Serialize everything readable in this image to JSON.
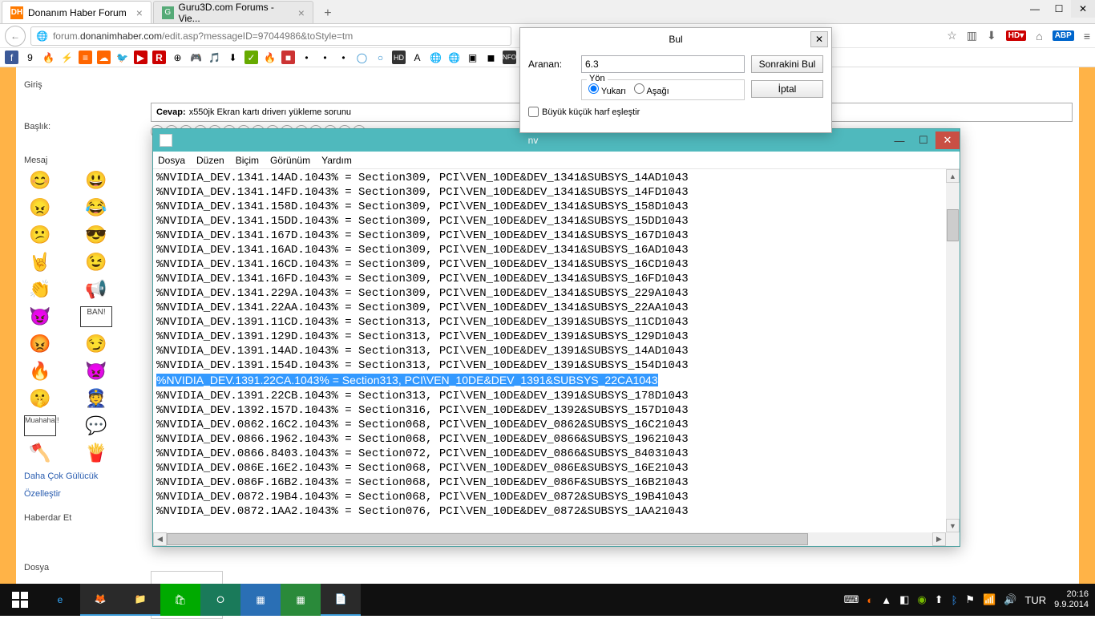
{
  "browser": {
    "tabs": [
      {
        "title": "Donanım Haber Forum",
        "favicon": "DH"
      },
      {
        "title": "Guru3D.com Forums - Vie...",
        "favicon": "G"
      }
    ],
    "url_display": "forum.donanimhaber.com/edit.asp?messageID=97044986&toStyle=tm",
    "url_host": "donanimhaber.com"
  },
  "find_dialog": {
    "title": "Bul",
    "search_label": "Aranan:",
    "search_value": "6.3",
    "next_btn": "Sonrakini Bul",
    "cancel_btn": "İptal",
    "direction_label": "Yön",
    "up_label": "Yukarı",
    "down_label": "Aşağı",
    "up_checked": true,
    "match_case_label": "Büyük küçük harf eşleştir"
  },
  "forum": {
    "giris": "Giriş",
    "baslik": "Başlık:",
    "mesaj": "Mesaj",
    "cevap_prefix": "Cevap:",
    "cevap_text": "x550jk Ekran kartı driverı yükleme sorunu",
    "more_smileys": "Daha Çok Gülücük",
    "customize": "Özelleştir",
    "notify": "Haberdar Et",
    "dosya": "Dosya"
  },
  "notepad": {
    "title": "nv",
    "menu": [
      "Dosya",
      "Düzen",
      "Biçim",
      "Görünüm",
      "Yardım"
    ],
    "selected_line_index": 14,
    "lines": [
      "%NVIDIA_DEV.1341.14AD.1043% = Section309, PCI\\VEN_10DE&DEV_1341&SUBSYS_14AD1043",
      "%NVIDIA_DEV.1341.14FD.1043% = Section309, PCI\\VEN_10DE&DEV_1341&SUBSYS_14FD1043",
      "%NVIDIA_DEV.1341.158D.1043% = Section309, PCI\\VEN_10DE&DEV_1341&SUBSYS_158D1043",
      "%NVIDIA_DEV.1341.15DD.1043% = Section309, PCI\\VEN_10DE&DEV_1341&SUBSYS_15DD1043",
      "%NVIDIA_DEV.1341.167D.1043% = Section309, PCI\\VEN_10DE&DEV_1341&SUBSYS_167D1043",
      "%NVIDIA_DEV.1341.16AD.1043% = Section309, PCI\\VEN_10DE&DEV_1341&SUBSYS_16AD1043",
      "%NVIDIA_DEV.1341.16CD.1043% = Section309, PCI\\VEN_10DE&DEV_1341&SUBSYS_16CD1043",
      "%NVIDIA_DEV.1341.16FD.1043% = Section309, PCI\\VEN_10DE&DEV_1341&SUBSYS_16FD1043",
      "%NVIDIA_DEV.1341.229A.1043% = Section309, PCI\\VEN_10DE&DEV_1341&SUBSYS_229A1043",
      "%NVIDIA_DEV.1341.22AA.1043% = Section309, PCI\\VEN_10DE&DEV_1341&SUBSYS_22AA1043",
      "%NVIDIA_DEV.1391.11CD.1043% = Section313, PCI\\VEN_10DE&DEV_1391&SUBSYS_11CD1043",
      "%NVIDIA_DEV.1391.129D.1043% = Section313, PCI\\VEN_10DE&DEV_1391&SUBSYS_129D1043",
      "%NVIDIA_DEV.1391.14AD.1043% = Section313, PCI\\VEN_10DE&DEV_1391&SUBSYS_14AD1043",
      "%NVIDIA_DEV.1391.154D.1043% = Section313, PCI\\VEN_10DE&DEV_1391&SUBSYS_154D1043",
      "%NVIDIA_DEV.1391.22CA.1043% = Section313, PCI\\VEN_10DE&DEV_1391&SUBSYS_22CA1043",
      "%NVIDIA_DEV.1391.22CB.1043% = Section313, PCI\\VEN_10DE&DEV_1391&SUBSYS_178D1043",
      "%NVIDIA_DEV.1392.157D.1043% = Section316, PCI\\VEN_10DE&DEV_1392&SUBSYS_157D1043",
      "%NVIDIA_DEV.0862.16C2.1043% = Section068, PCI\\VEN_10DE&DEV_0862&SUBSYS_16C21043",
      "%NVIDIA_DEV.0866.1962.1043% = Section068, PCI\\VEN_10DE&DEV_0866&SUBSYS_19621043",
      "%NVIDIA_DEV.0866.8403.1043% = Section072, PCI\\VEN_10DE&DEV_0866&SUBSYS_84031043",
      "%NVIDIA_DEV.086E.16E2.1043% = Section068, PCI\\VEN_10DE&DEV_086E&SUBSYS_16E21043",
      "%NVIDIA_DEV.086F.16B2.1043% = Section068, PCI\\VEN_10DE&DEV_086F&SUBSYS_16B21043",
      "%NVIDIA_DEV.0872.19B4.1043% = Section068, PCI\\VEN_10DE&DEV_0872&SUBSYS_19B41043",
      "%NVIDIA_DEV.0872.1AA2.1043% = Section076, PCI\\VEN_10DE&DEV_0872&SUBSYS_1AA21043"
    ]
  },
  "taskbar": {
    "time": "20:16",
    "date": "9.9.2014",
    "lang": "TUR"
  }
}
